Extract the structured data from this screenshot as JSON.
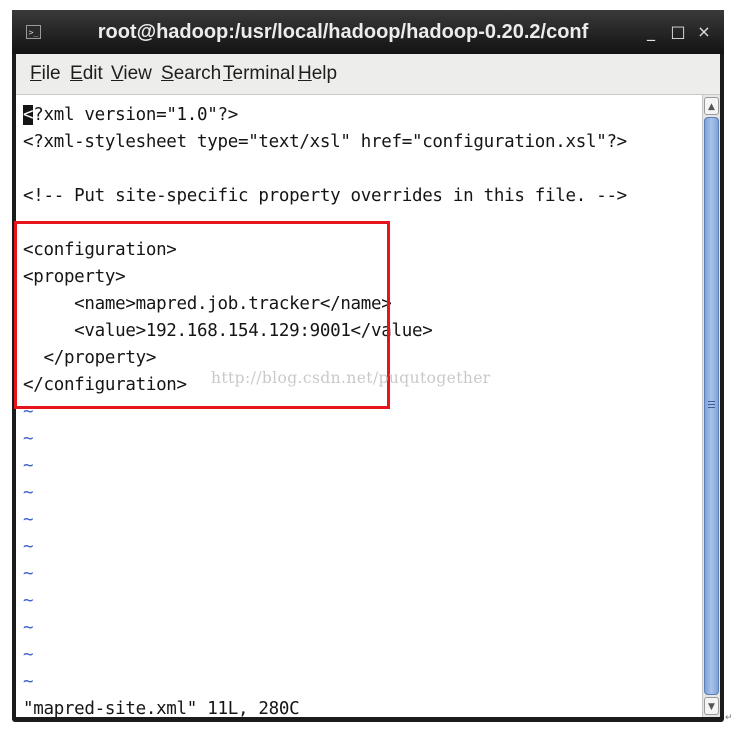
{
  "window": {
    "title": "root@hadoop:/usr/local/hadoop/hadoop-0.20.2/conf",
    "controls": {
      "minimize": "_",
      "maximize": "□",
      "close": "×"
    }
  },
  "menu": {
    "items": [
      {
        "label": "File",
        "mnemonic": "F",
        "rest": "ile"
      },
      {
        "label": "Edit",
        "mnemonic": "E",
        "rest": "dit"
      },
      {
        "label": "View",
        "mnemonic": "V",
        "rest": "iew"
      },
      {
        "label": "Search",
        "mnemonic": "S",
        "rest": "earch"
      },
      {
        "label": "Terminal",
        "mnemonic": "T",
        "rest": "erminal"
      },
      {
        "label": "Help",
        "mnemonic": "H",
        "rest": "elp"
      }
    ]
  },
  "editor": {
    "cursor_char": "<",
    "line1_rest": "?xml version=\"1.0\"?>",
    "lines": [
      "<?xml-stylesheet type=\"text/xsl\" href=\"configuration.xsl\"?>",
      "",
      "<!-- Put site-specific property overrides in this file. -->",
      "",
      "<configuration>",
      "<property>",
      "     <name>mapred.job.tracker</name>",
      "     <value>192.168.154.129:9001</value>",
      "  </property>",
      "</configuration>"
    ],
    "tilde": "~",
    "status": "\"mapred-site.xml\" 11L, 280C"
  },
  "watermark": "http://blog.csdn.net/puqutogether",
  "corner_mark": "↵",
  "colors": {
    "highlight_border": "#e8141c",
    "tilde": "#3a5fcd",
    "scroll_thumb": "#7fa3d8"
  }
}
